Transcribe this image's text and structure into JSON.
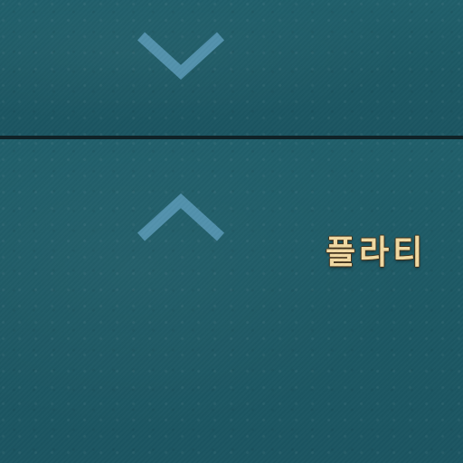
{
  "scroll": {
    "down_icon": "chevron-down-icon",
    "up_icon": "chevron-up-icon"
  },
  "selection": {
    "label": "플라티"
  },
  "colors": {
    "panel_background": "#1e5a66",
    "divider": "#0f2227",
    "arrow": "#4f8fab",
    "label_text": "#f1d9a2"
  }
}
